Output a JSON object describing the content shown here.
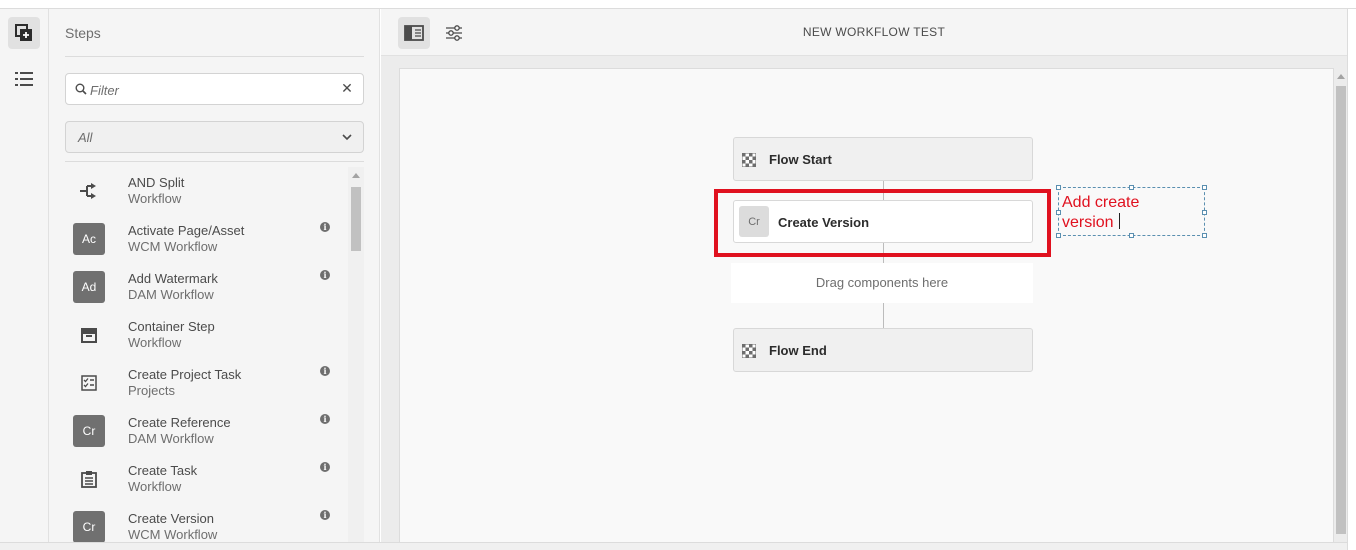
{
  "sidebar_panel": {
    "title": "Steps",
    "filter": {
      "placeholder": "Filter",
      "value": ""
    },
    "group_select": {
      "selected": "All"
    },
    "items": [
      {
        "name": "AND Split",
        "category": "Workflow",
        "icon": "and-split-icon",
        "badge": "",
        "info": false
      },
      {
        "name": "Activate Page/Asset",
        "category": "WCM Workflow",
        "icon": "badge",
        "badge": "Ac",
        "info": true
      },
      {
        "name": "Add Watermark",
        "category": "DAM Workflow",
        "icon": "badge",
        "badge": "Ad",
        "info": true
      },
      {
        "name": "Container Step",
        "category": "Workflow",
        "icon": "container-step-icon",
        "badge": "",
        "info": false
      },
      {
        "name": "Create Project Task",
        "category": "Projects",
        "icon": "task-list-icon",
        "badge": "",
        "info": true
      },
      {
        "name": "Create Reference",
        "category": "DAM Workflow",
        "icon": "badge",
        "badge": "Cr",
        "info": true
      },
      {
        "name": "Create Task",
        "category": "Workflow",
        "icon": "clipboard-icon",
        "badge": "",
        "info": true
      },
      {
        "name": "Create Version",
        "category": "WCM Workflow",
        "icon": "badge",
        "badge": "Cr",
        "info": true
      }
    ]
  },
  "toolbar": {
    "workflow_title": "NEW WORKFLOW TEST"
  },
  "canvas": {
    "flow_start": "Flow Start",
    "step": {
      "badge": "Cr",
      "label": "Create Version"
    },
    "drop_zone": "Drag components here",
    "flow_end": "Flow End"
  },
  "annotation": {
    "text": "Add create version",
    "color": "#e0111f"
  },
  "colors": {
    "highlight": "#e0111f",
    "badge_bg": "#707070"
  }
}
